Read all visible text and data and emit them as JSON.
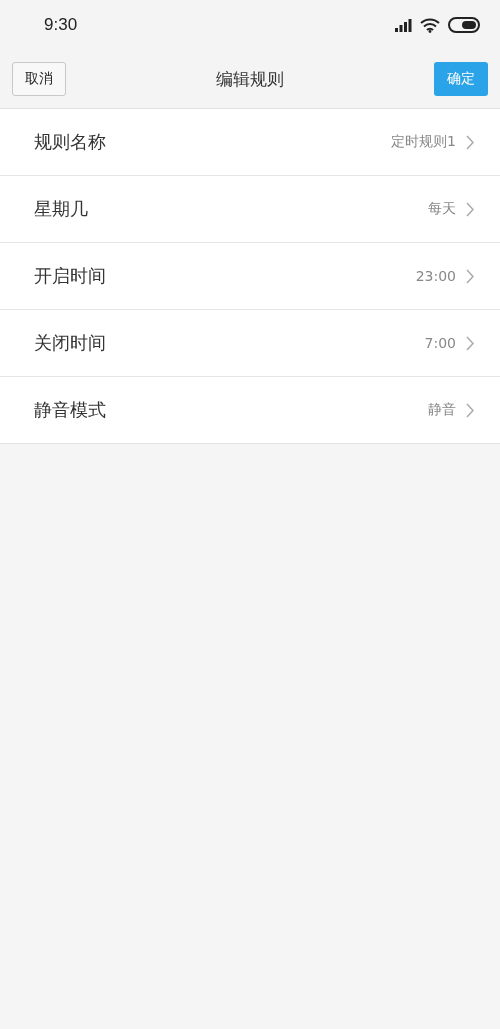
{
  "status_bar": {
    "time": "9:30"
  },
  "header": {
    "cancel": "取消",
    "title": "编辑规则",
    "confirm": "确定"
  },
  "rows": [
    {
      "label": "规则名称",
      "value": "定时规则1"
    },
    {
      "label": "星期几",
      "value": "每天"
    },
    {
      "label": "开启时间",
      "value": "23:00"
    },
    {
      "label": "关闭时间",
      "value": "7:00"
    },
    {
      "label": "静音模式",
      "value": "静音"
    }
  ]
}
